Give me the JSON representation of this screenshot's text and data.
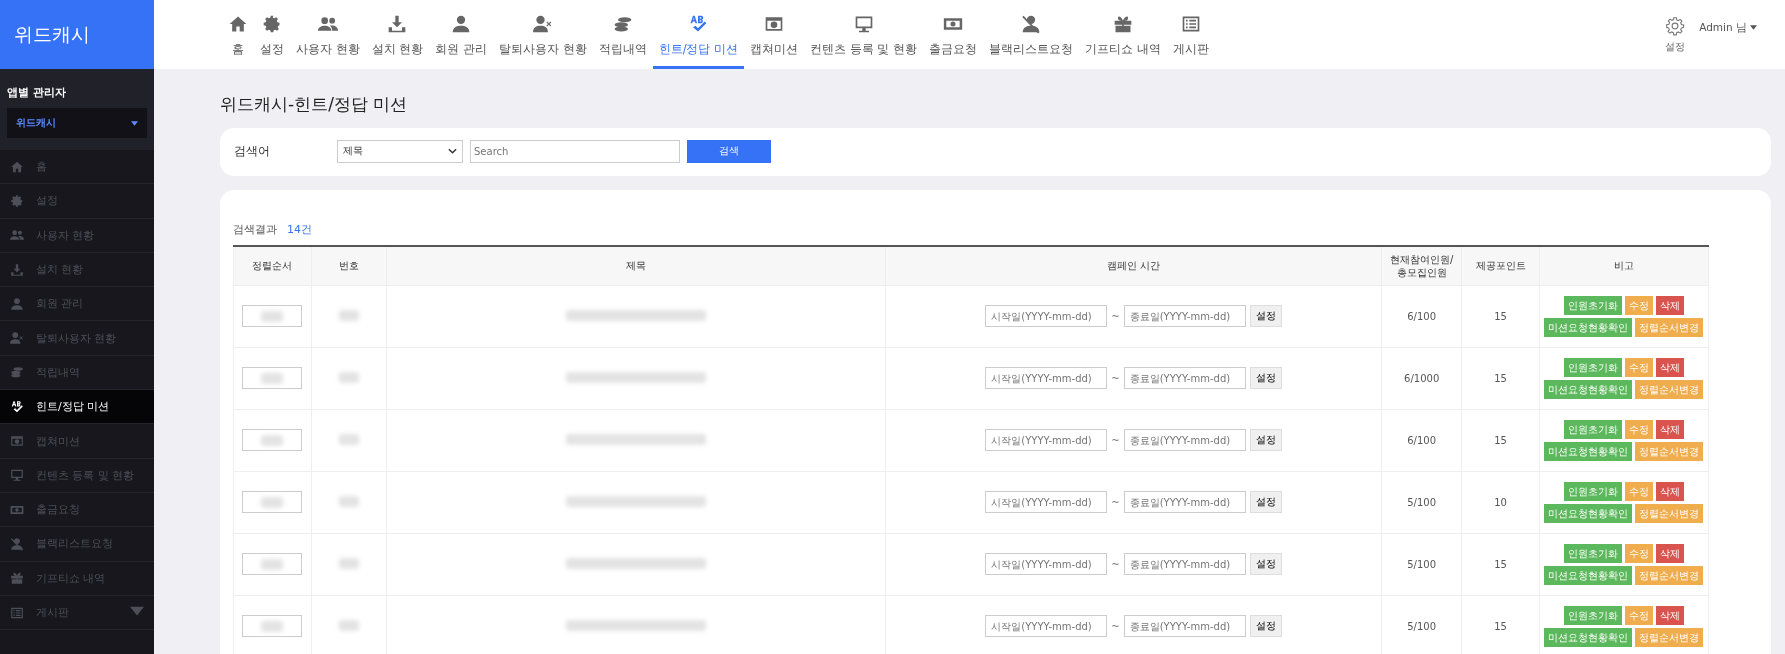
{
  "brand": "위드캐시",
  "nav": [
    {
      "label": "홈",
      "selected": false
    },
    {
      "label": "설정",
      "selected": false
    },
    {
      "label": "사용자 현황",
      "selected": false
    },
    {
      "label": "설치 현황",
      "selected": false
    },
    {
      "label": "회원 관리",
      "selected": false
    },
    {
      "label": "탈퇴사용자 현황",
      "selected": false
    },
    {
      "label": "적립내역",
      "selected": false
    },
    {
      "label": "힌트/정답 미션",
      "selected": true
    },
    {
      "label": "캡쳐미션",
      "selected": false
    },
    {
      "label": "컨텐츠 등록 및 현황",
      "selected": false
    },
    {
      "label": "출금요청",
      "selected": false
    },
    {
      "label": "블랙리스트요청",
      "selected": false
    },
    {
      "label": "기프티쇼 내역",
      "selected": false
    },
    {
      "label": "게시판",
      "selected": false
    }
  ],
  "header_right": {
    "settings_label": "설정",
    "user_label": "Admin 님"
  },
  "sidebar": {
    "section_title": "앱별 관리자",
    "app_select": "위드캐시",
    "items": [
      {
        "label": "홈",
        "selected": false,
        "submenu": false
      },
      {
        "label": "설정",
        "selected": false,
        "submenu": false
      },
      {
        "label": "사용자 현황",
        "selected": false,
        "submenu": false
      },
      {
        "label": "설치 현황",
        "selected": false,
        "submenu": false
      },
      {
        "label": "회원 관리",
        "selected": false,
        "submenu": false
      },
      {
        "label": "탈퇴사용자 현황",
        "selected": false,
        "submenu": false
      },
      {
        "label": "적립내역",
        "selected": false,
        "submenu": false
      },
      {
        "label": "힌트/정답 미션",
        "selected": true,
        "submenu": false
      },
      {
        "label": "캡쳐미션",
        "selected": false,
        "submenu": false
      },
      {
        "label": "컨텐츠 등록 및 현황",
        "selected": false,
        "submenu": false
      },
      {
        "label": "출금요청",
        "selected": false,
        "submenu": false
      },
      {
        "label": "블랙리스트요청",
        "selected": false,
        "submenu": false
      },
      {
        "label": "기프티쇼 내역",
        "selected": false,
        "submenu": false
      },
      {
        "label": "게시판",
        "selected": false,
        "submenu": true
      }
    ]
  },
  "page_title": "위드캐시-힌트/정답 미션",
  "search": {
    "label": "검색어",
    "select_value": "제목",
    "placeholder": "Search",
    "button": "검색"
  },
  "results": {
    "label": "검색결과",
    "count": "14건"
  },
  "table": {
    "columns": [
      "정렬순서",
      "번호",
      "제목",
      "캠페인 시간",
      "현재참여인원/\n총모집인원",
      "제공포인트",
      "비고"
    ],
    "rows": [
      {
        "date_start_placeholder": "시작일(YYYY-mm-dd)",
        "date_separator": "~",
        "date_end_placeholder": "종료일(YYYY-mm-dd)",
        "date_button": "설정",
        "participants": "6/100",
        "points": "15",
        "actions": [
          {
            "label": "인원초기화",
            "kind": "success"
          },
          {
            "label": "수정",
            "kind": "warning"
          },
          {
            "label": "삭제",
            "kind": "danger"
          },
          {
            "label": "미션요청현황확인",
            "kind": "success"
          },
          {
            "label": "정렬순서변경",
            "kind": "warning"
          }
        ]
      },
      {
        "date_start_placeholder": "시작일(YYYY-mm-dd)",
        "date_separator": "~",
        "date_end_placeholder": "종료일(YYYY-mm-dd)",
        "date_button": "설정",
        "participants": "6/1000",
        "points": "15",
        "actions": [
          {
            "label": "인원초기화",
            "kind": "success"
          },
          {
            "label": "수정",
            "kind": "warning"
          },
          {
            "label": "삭제",
            "kind": "danger"
          },
          {
            "label": "미션요청현황확인",
            "kind": "success"
          },
          {
            "label": "정렬순서변경",
            "kind": "warning"
          }
        ]
      },
      {
        "date_start_placeholder": "시작일(YYYY-mm-dd)",
        "date_separator": "~",
        "date_end_placeholder": "종료일(YYYY-mm-dd)",
        "date_button": "설정",
        "participants": "6/100",
        "points": "15",
        "actions": [
          {
            "label": "인원초기화",
            "kind": "success"
          },
          {
            "label": "수정",
            "kind": "warning"
          },
          {
            "label": "삭제",
            "kind": "danger"
          },
          {
            "label": "미션요청현황확인",
            "kind": "success"
          },
          {
            "label": "정렬순서변경",
            "kind": "warning"
          }
        ]
      },
      {
        "date_start_placeholder": "시작일(YYYY-mm-dd)",
        "date_separator": "~",
        "date_end_placeholder": "종료일(YYYY-mm-dd)",
        "date_button": "설정",
        "participants": "5/100",
        "points": "10",
        "actions": [
          {
            "label": "인원초기화",
            "kind": "success"
          },
          {
            "label": "수정",
            "kind": "warning"
          },
          {
            "label": "삭제",
            "kind": "danger"
          },
          {
            "label": "미션요청현황확인",
            "kind": "success"
          },
          {
            "label": "정렬순서변경",
            "kind": "warning"
          }
        ]
      },
      {
        "date_start_placeholder": "시작일(YYYY-mm-dd)",
        "date_separator": "~",
        "date_end_placeholder": "종료일(YYYY-mm-dd)",
        "date_button": "설정",
        "participants": "5/100",
        "points": "15",
        "actions": [
          {
            "label": "인원초기화",
            "kind": "success"
          },
          {
            "label": "수정",
            "kind": "warning"
          },
          {
            "label": "삭제",
            "kind": "danger"
          },
          {
            "label": "미션요청현황확인",
            "kind": "success"
          },
          {
            "label": "정렬순서변경",
            "kind": "warning"
          }
        ]
      },
      {
        "date_start_placeholder": "시작일(YYYY-mm-dd)",
        "date_separator": "~",
        "date_end_placeholder": "종료일(YYYY-mm-dd)",
        "date_button": "설정",
        "participants": "5/100",
        "points": "15",
        "actions": [
          {
            "label": "인원초기화",
            "kind": "success"
          },
          {
            "label": "수정",
            "kind": "warning"
          },
          {
            "label": "삭제",
            "kind": "danger"
          },
          {
            "label": "미션요청현황확인",
            "kind": "success"
          },
          {
            "label": "정렬순서변경",
            "kind": "warning"
          }
        ]
      }
    ]
  }
}
